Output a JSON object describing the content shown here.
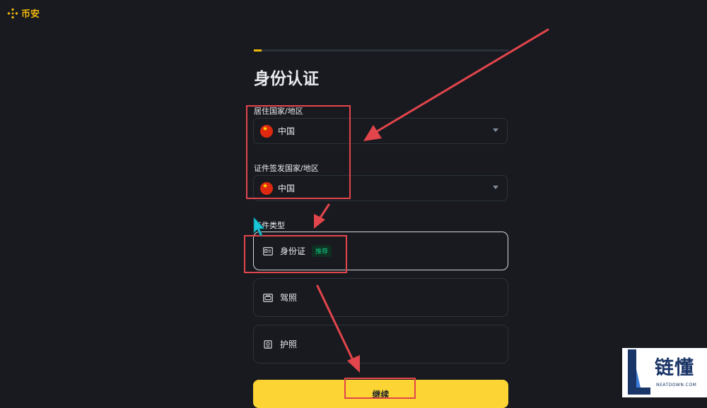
{
  "brand": {
    "name": "币安",
    "color": "#f0b90b"
  },
  "progress": {
    "current_step": 1,
    "fraction": 0.03
  },
  "page": {
    "title": "身份认证"
  },
  "residence": {
    "label": "居住国家/地区",
    "value": "中国",
    "flag_icon": "china-flag-icon"
  },
  "issuing": {
    "label": "证件签发国家/地区",
    "value": "中国",
    "flag_icon": "china-flag-icon"
  },
  "document_type": {
    "label": "证件类型",
    "options": [
      {
        "label": "身份证",
        "badge": "推荐",
        "icon": "id-card-icon",
        "selected": true
      },
      {
        "label": "驾照",
        "icon": "driver-license-icon",
        "selected": false
      },
      {
        "label": "护照",
        "icon": "passport-icon",
        "selected": false
      }
    ]
  },
  "actions": {
    "continue_label": "继续",
    "continue_color": "#fcd535"
  },
  "annotation": {
    "highlight_color": "#e2454b",
    "arrow_color": "#e2454b"
  },
  "watermark": {
    "text": "链懂",
    "subtext": "NEATDOWN.COM"
  }
}
